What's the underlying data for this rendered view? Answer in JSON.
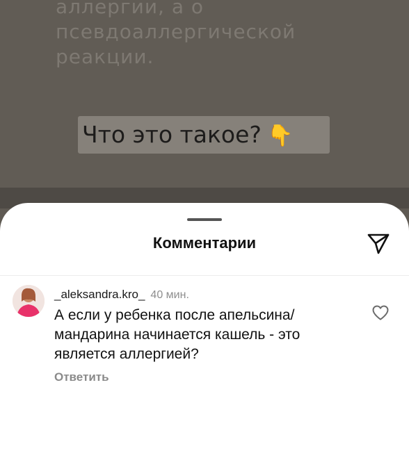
{
  "post": {
    "text_lines": [
      "аллергии, а о",
      "псевдоаллергической",
      "реакции."
    ],
    "question": "Что это такое?",
    "hand_emoji": "👇"
  },
  "sheet": {
    "title": "Комментарии",
    "send_icon": "send-paper-plane-icon"
  },
  "comment": {
    "username": "_aleksandra.kro_",
    "time": "40 мин.",
    "text_lines": [
      "А если у ребенка после апельсина/",
      "мандарина начинается кашель - это",
      "является аллергией?"
    ],
    "reply_label": "Ответить",
    "like_icon": "heart-outline-icon"
  },
  "colors": {
    "overlay": "#615c55",
    "sheet_bg": "#ffffff",
    "muted_text": "#8e8e8e"
  }
}
